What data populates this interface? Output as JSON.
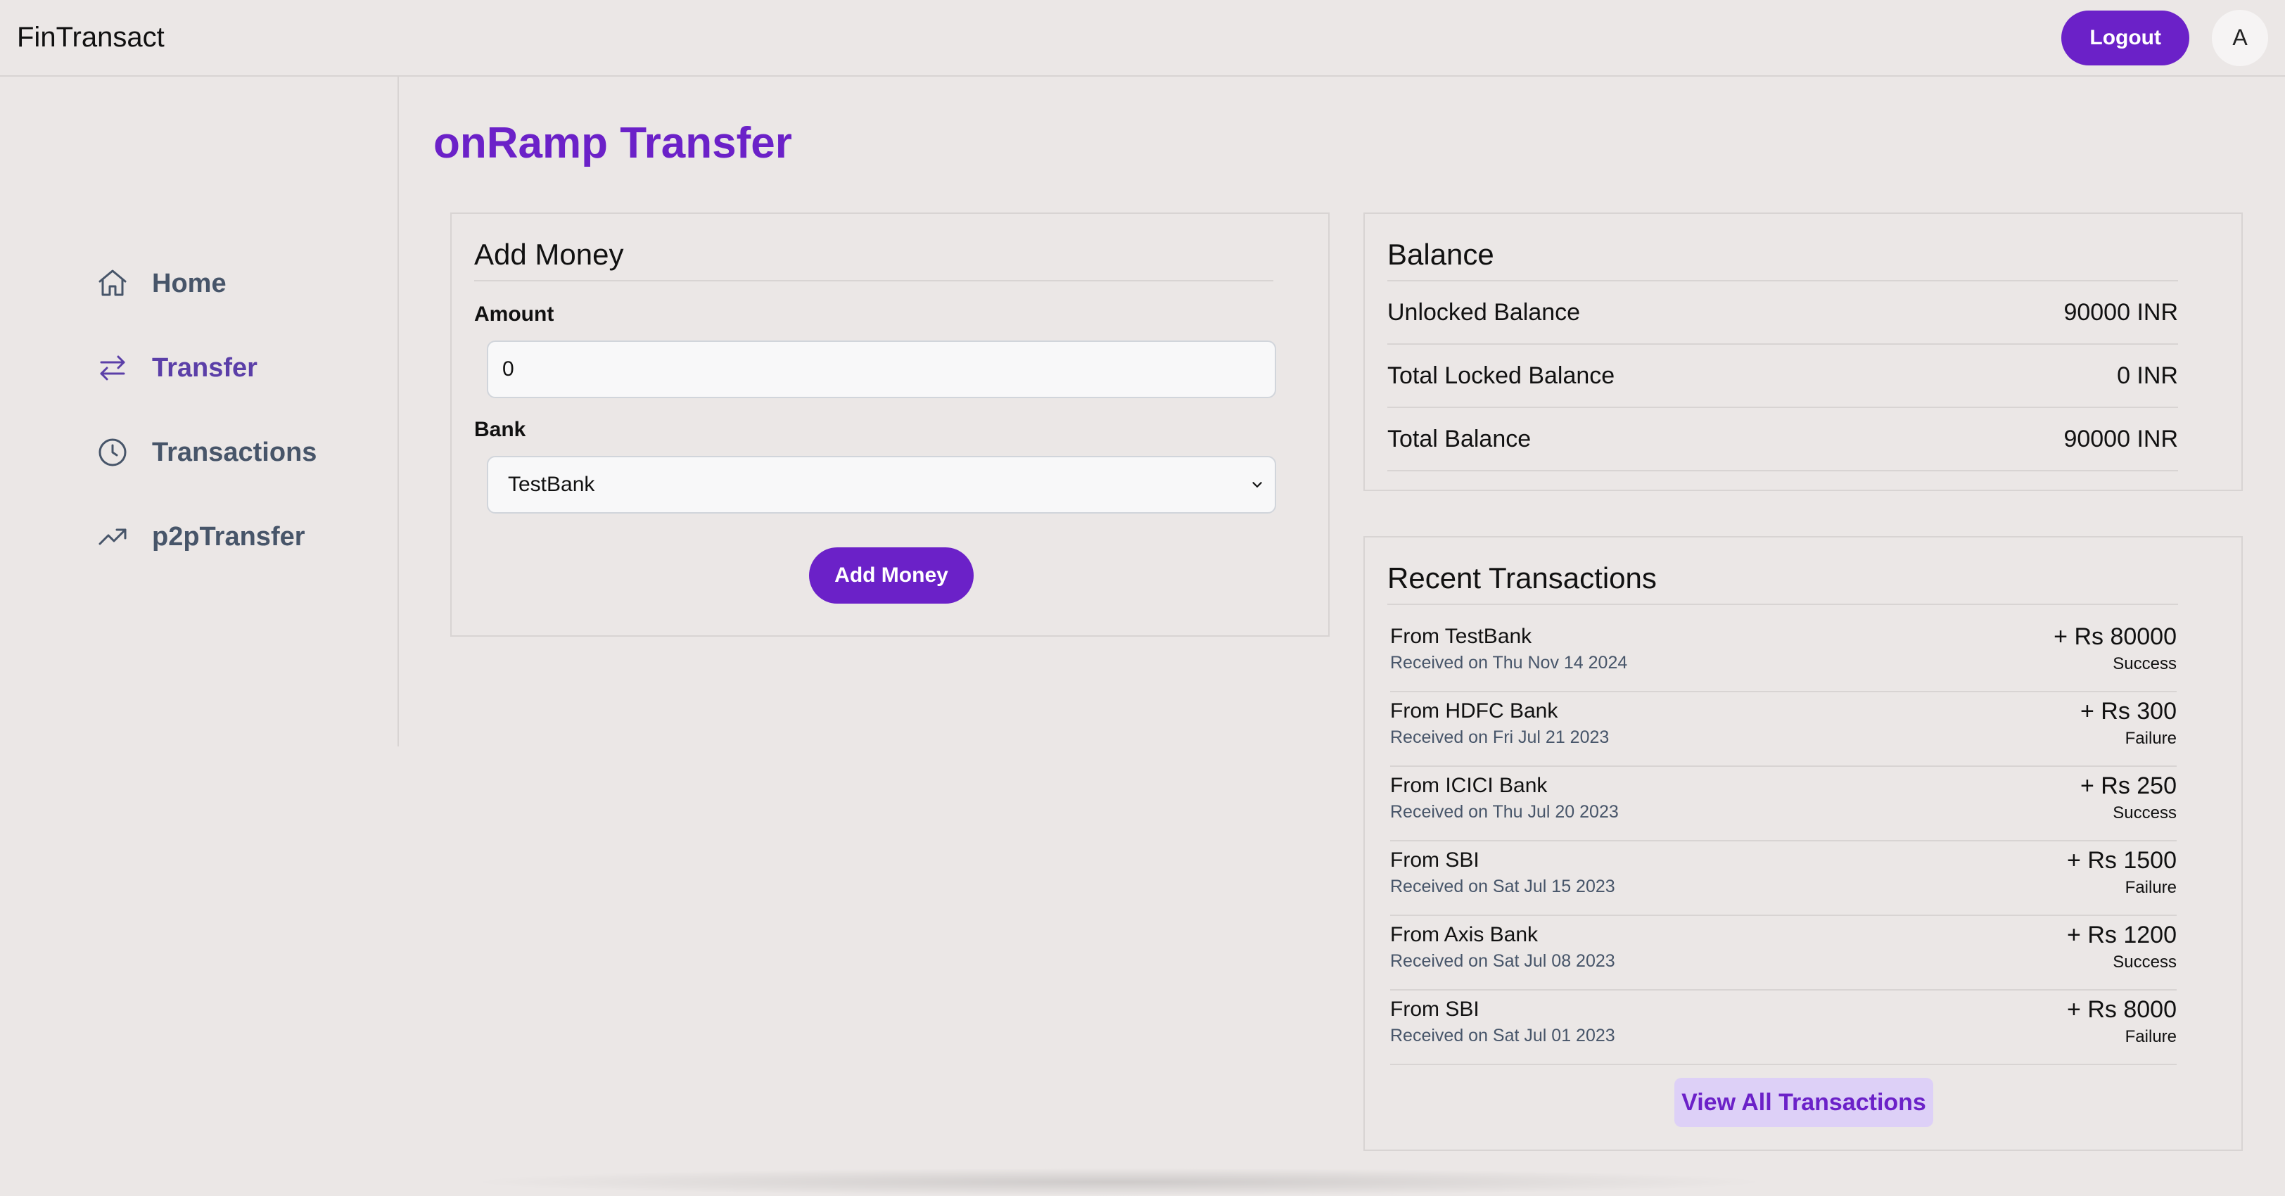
{
  "app": {
    "brand": "FinTransact",
    "logout_label": "Logout",
    "avatar_initial": "A"
  },
  "sidebar": {
    "items": [
      {
        "label": "Home",
        "icon": "home-icon",
        "active": false
      },
      {
        "label": "Transfer",
        "icon": "transfer-icon",
        "active": true
      },
      {
        "label": "Transactions",
        "icon": "clock-icon",
        "active": false
      },
      {
        "label": "p2pTransfer",
        "icon": "trending-up-icon",
        "active": false
      }
    ]
  },
  "page": {
    "title": "onRamp Transfer"
  },
  "add_money": {
    "title": "Add Money",
    "amount_label": "Amount",
    "amount_value": "0",
    "bank_label": "Bank",
    "bank_selected": "TestBank",
    "button_label": "Add Money"
  },
  "balance": {
    "title": "Balance",
    "rows": [
      {
        "label": "Unlocked Balance",
        "value": "90000 INR"
      },
      {
        "label": "Total Locked Balance",
        "value": "0 INR"
      },
      {
        "label": "Total Balance",
        "value": "90000 INR"
      }
    ]
  },
  "recent": {
    "title": "Recent Transactions",
    "items": [
      {
        "from": "From TestBank",
        "date": "Received on Thu Nov 14 2024",
        "amount": "+ Rs 80000",
        "status": "Success"
      },
      {
        "from": "From HDFC Bank",
        "date": "Received on Fri Jul 21 2023",
        "amount": "+ Rs 300",
        "status": "Failure"
      },
      {
        "from": "From ICICI Bank",
        "date": "Received on Thu Jul 20 2023",
        "amount": "+ Rs 250",
        "status": "Success"
      },
      {
        "from": "From SBI",
        "date": "Received on Sat Jul 15 2023",
        "amount": "+ Rs 1500",
        "status": "Failure"
      },
      {
        "from": "From Axis Bank",
        "date": "Received on Sat Jul 08 2023",
        "amount": "+ Rs 1200",
        "status": "Success"
      },
      {
        "from": "From SBI",
        "date": "Received on Sat Jul 01 2023",
        "amount": "+ Rs 8000",
        "status": "Failure"
      }
    ],
    "view_all_label": "View All Transactions"
  },
  "colors": {
    "accent": "#6b21c8",
    "background": "#ebe7e6",
    "muted_text": "#475569"
  }
}
